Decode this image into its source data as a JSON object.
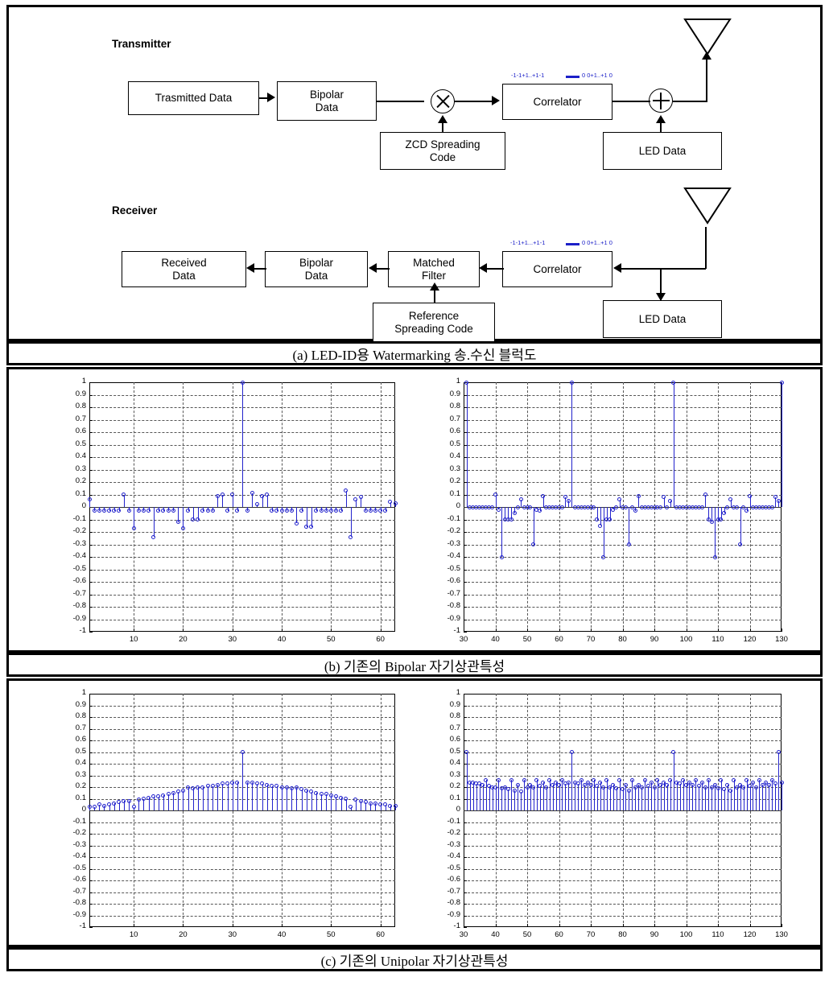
{
  "figure": {
    "captions": {
      "a": "(a) LED-ID용 Watermarking 송.수신 블럭도",
      "b": "(b) 기존의 Bipolar 자기상관특성",
      "c": "(c) 기존의 Unipolar 자기상관특성"
    }
  },
  "blockdiagram": {
    "transmitter_title": "Transmitter",
    "receiver_title": "Receiver",
    "tx_blocks": [
      {
        "id": "transmitted-data",
        "label": "Trasmitted Data"
      },
      {
        "id": "bipolar-data",
        "label": "Bipolar\nData"
      },
      {
        "id": "zcd-spreading-code",
        "label": "ZCD Spreading\nCode"
      },
      {
        "id": "correlator-tx",
        "label": "Correlator"
      },
      {
        "id": "led-data-tx",
        "label": "LED Data"
      }
    ],
    "rx_blocks": [
      {
        "id": "received-data",
        "label": "Received\nData"
      },
      {
        "id": "bipolar-data-rx",
        "label": "Bipolar\nData"
      },
      {
        "id": "matched-filter",
        "label": "Matched\nFilter"
      },
      {
        "id": "reference-spreading-code",
        "label": "Reference\nSpreading Code"
      },
      {
        "id": "correlator-rx",
        "label": "Correlator"
      },
      {
        "id": "led-data-rx",
        "label": "LED Data"
      }
    ],
    "bit_annotations": {
      "tx_left": "-1-1+1..+1-1",
      "tx_right": "0 0+1..+1 0",
      "rx_left": "-1-1+1...+1-1",
      "rx_right": "0 0+1..+1 0"
    },
    "colors": {
      "bits": "#1c20c8",
      "line": "#000000"
    }
  },
  "chart_data": [
    {
      "id": "b-left",
      "type": "stem",
      "title": "",
      "xlabel": "",
      "ylabel": "",
      "xlim": [
        1,
        63
      ],
      "ylim": [
        -1,
        1
      ],
      "xticks": [
        10,
        20,
        30,
        40,
        50,
        60
      ],
      "yticks": [
        "-1",
        "-0.9",
        "-0.8",
        "-0.7",
        "-0.6",
        "-0.5",
        "-0.4",
        "-0.3",
        "-0.2",
        "-0.1",
        "0",
        "0.1",
        "0.2",
        "0.3",
        "0.4",
        "0.5",
        "0.6",
        "0.7",
        "0.8",
        "0.9",
        "1"
      ],
      "grid": true,
      "x": [
        1,
        2,
        3,
        4,
        5,
        6,
        7,
        8,
        9,
        10,
        11,
        12,
        13,
        14,
        15,
        16,
        17,
        18,
        19,
        20,
        21,
        22,
        23,
        24,
        25,
        26,
        27,
        28,
        29,
        30,
        31,
        32,
        33,
        34,
        35,
        36,
        37,
        38,
        39,
        40,
        41,
        42,
        43,
        44,
        45,
        46,
        47,
        48,
        49,
        50,
        51,
        52,
        53,
        54,
        55,
        56,
        57,
        58,
        59,
        60,
        61,
        62,
        63
      ],
      "y": [
        0.06,
        -0.03,
        -0.03,
        -0.03,
        -0.03,
        -0.03,
        -0.03,
        0.1,
        -0.03,
        -0.17,
        -0.03,
        -0.03,
        -0.03,
        -0.24,
        -0.03,
        -0.03,
        -0.03,
        -0.03,
        -0.12,
        -0.17,
        -0.03,
        -0.1,
        -0.1,
        -0.03,
        -0.03,
        -0.03,
        0.09,
        0.1,
        -0.03,
        0.1,
        -0.03,
        1.0,
        -0.03,
        0.11,
        0.02,
        0.09,
        0.1,
        -0.03,
        -0.03,
        -0.03,
        -0.03,
        -0.03,
        -0.13,
        -0.03,
        -0.16,
        -0.16,
        -0.03,
        -0.03,
        -0.03,
        -0.03,
        -0.03,
        -0.03,
        0.13,
        -0.24,
        0.06,
        0.08,
        -0.03,
        -0.03,
        -0.03,
        -0.03,
        -0.03,
        0.04,
        0.03
      ]
    },
    {
      "id": "b-right",
      "type": "stem",
      "title": "",
      "xlabel": "",
      "ylabel": "",
      "xlim": [
        30,
        130
      ],
      "ylim": [
        -1,
        1
      ],
      "xticks": [
        30,
        40,
        50,
        60,
        70,
        80,
        90,
        100,
        110,
        120,
        130
      ],
      "yticks": [
        "-1",
        "-0.9",
        "-0.8",
        "-0.7",
        "-0.6",
        "-0.5",
        "-0.4",
        "-0.3",
        "-0.2",
        "-0.1",
        "0",
        "0.1",
        "0.2",
        "0.3",
        "0.4",
        "0.5",
        "0.6",
        "0.7",
        "0.8",
        "0.9",
        "1"
      ],
      "grid": true,
      "x": [
        31,
        32,
        33,
        34,
        35,
        36,
        37,
        38,
        39,
        40,
        41,
        42,
        43,
        44,
        45,
        46,
        47,
        48,
        49,
        50,
        51,
        52,
        53,
        54,
        55,
        56,
        57,
        58,
        59,
        60,
        61,
        62,
        63,
        64,
        65,
        66,
        67,
        68,
        69,
        70,
        71,
        72,
        73,
        74,
        75,
        76,
        77,
        78,
        79,
        80,
        81,
        82,
        83,
        84,
        85,
        86,
        87,
        88,
        89,
        90,
        91,
        92,
        93,
        94,
        95,
        96,
        97,
        98,
        99,
        100,
        101,
        102,
        103,
        104,
        105,
        106,
        107,
        108,
        109,
        110,
        111,
        112,
        113,
        114,
        115,
        116,
        117,
        118,
        119,
        120,
        121,
        122,
        123,
        124,
        125,
        126,
        127,
        128,
        129,
        130
      ],
      "y": [
        1.0,
        0,
        0,
        0,
        0,
        0,
        0,
        0,
        0,
        0.1,
        -0.02,
        -0.4,
        -0.1,
        -0.1,
        -0.1,
        -0.05,
        0,
        0.06,
        0,
        0,
        0,
        -0.3,
        -0.02,
        -0.03,
        0.09,
        0,
        0,
        0,
        0,
        0,
        0,
        0.08,
        0.05,
        1.0,
        0,
        0,
        0,
        0,
        0,
        0,
        0,
        -0.1,
        -0.15,
        -0.4,
        -0.1,
        -0.1,
        -0.02,
        0,
        0.06,
        0,
        0,
        -0.3,
        0,
        -0.03,
        0.09,
        0,
        0,
        0,
        0,
        0,
        0,
        0,
        0.08,
        0,
        0.05,
        1.0,
        0,
        0,
        0,
        0,
        0,
        0,
        0,
        0,
        0,
        0.1,
        -0.1,
        -0.12,
        -0.4,
        -0.1,
        -0.1,
        -0.05,
        0,
        0.06,
        0,
        0,
        -0.3,
        0,
        -0.03,
        0.09,
        0,
        0,
        0,
        0,
        0,
        0,
        0,
        0.08,
        0.05,
        1.0,
        0
      ]
    },
    {
      "id": "c-left",
      "type": "stem",
      "title": "",
      "xlabel": "",
      "ylabel": "",
      "xlim": [
        1,
        63
      ],
      "ylim": [
        -1,
        1
      ],
      "xticks": [
        10,
        20,
        30,
        40,
        50,
        60
      ],
      "yticks": [
        "-1",
        "-0.9",
        "-0.8",
        "-0.7",
        "-0.6",
        "-0.5",
        "-0.4",
        "-0.3",
        "-0.2",
        "-0.1",
        "0",
        "0.1",
        "0.2",
        "0.3",
        "0.4",
        "0.5",
        "0.6",
        "0.7",
        "0.8",
        "0.9",
        "1"
      ],
      "grid": true,
      "x": [
        1,
        2,
        3,
        4,
        5,
        6,
        7,
        8,
        9,
        10,
        11,
        12,
        13,
        14,
        15,
        16,
        17,
        18,
        19,
        20,
        21,
        22,
        23,
        24,
        25,
        26,
        27,
        28,
        29,
        30,
        31,
        32,
        33,
        34,
        35,
        36,
        37,
        38,
        39,
        40,
        41,
        42,
        43,
        44,
        45,
        46,
        47,
        48,
        49,
        50,
        51,
        52,
        53,
        54,
        55,
        56,
        57,
        58,
        59,
        60,
        61,
        62,
        63
      ],
      "y": [
        0.03,
        0.03,
        0.05,
        0.04,
        0.05,
        0.06,
        0.07,
        0.08,
        0.08,
        0.03,
        0.09,
        0.1,
        0.11,
        0.12,
        0.12,
        0.13,
        0.14,
        0.15,
        0.16,
        0.17,
        0.2,
        0.19,
        0.2,
        0.2,
        0.21,
        0.21,
        0.22,
        0.23,
        0.23,
        0.24,
        0.24,
        0.5,
        0.24,
        0.24,
        0.23,
        0.23,
        0.22,
        0.21,
        0.21,
        0.2,
        0.2,
        0.19,
        0.2,
        0.18,
        0.17,
        0.16,
        0.15,
        0.14,
        0.14,
        0.13,
        0.12,
        0.11,
        0.1,
        0.03,
        0.09,
        0.08,
        0.07,
        0.06,
        0.06,
        0.05,
        0.05,
        0.04,
        0.04
      ]
    },
    {
      "id": "c-right",
      "type": "stem",
      "title": "",
      "xlabel": "",
      "ylabel": "",
      "xlim": [
        30,
        130
      ],
      "ylim": [
        -1,
        1
      ],
      "xticks": [
        30,
        40,
        50,
        60,
        70,
        80,
        90,
        100,
        110,
        120,
        130
      ],
      "yticks": [
        "-1",
        "-0.9",
        "-0.8",
        "-0.7",
        "-0.6",
        "-0.5",
        "-0.4",
        "-0.3",
        "-0.2",
        "-0.1",
        "0",
        "0.1",
        "0.2",
        "0.3",
        "0.4",
        "0.5",
        "0.6",
        "0.7",
        "0.8",
        "0.9",
        "1"
      ],
      "grid": true,
      "x": [
        31,
        32,
        33,
        34,
        35,
        36,
        37,
        38,
        39,
        40,
        41,
        42,
        43,
        44,
        45,
        46,
        47,
        48,
        49,
        50,
        51,
        52,
        53,
        54,
        55,
        56,
        57,
        58,
        59,
        60,
        61,
        62,
        63,
        64,
        65,
        66,
        67,
        68,
        69,
        70,
        71,
        72,
        73,
        74,
        75,
        76,
        77,
        78,
        79,
        80,
        81,
        82,
        83,
        84,
        85,
        86,
        87,
        88,
        89,
        90,
        91,
        92,
        93,
        94,
        95,
        96,
        97,
        98,
        99,
        100,
        101,
        102,
        103,
        104,
        105,
        106,
        107,
        108,
        109,
        110,
        111,
        112,
        113,
        114,
        115,
        116,
        117,
        118,
        119,
        120,
        121,
        122,
        123,
        124,
        125,
        126,
        127,
        128,
        129,
        130
      ],
      "y": [
        0.5,
        0.24,
        0.24,
        0.23,
        0.23,
        0.22,
        0.26,
        0.21,
        0.2,
        0.2,
        0.26,
        0.19,
        0.2,
        0.18,
        0.26,
        0.17,
        0.22,
        0.16,
        0.26,
        0.2,
        0.22,
        0.2,
        0.26,
        0.21,
        0.24,
        0.2,
        0.26,
        0.22,
        0.24,
        0.22,
        0.26,
        0.23,
        0.24,
        0.5,
        0.24,
        0.23,
        0.26,
        0.22,
        0.24,
        0.22,
        0.26,
        0.21,
        0.24,
        0.2,
        0.26,
        0.2,
        0.22,
        0.19,
        0.26,
        0.18,
        0.22,
        0.17,
        0.26,
        0.2,
        0.22,
        0.2,
        0.26,
        0.21,
        0.24,
        0.2,
        0.26,
        0.22,
        0.24,
        0.22,
        0.26,
        0.5,
        0.24,
        0.23,
        0.26,
        0.22,
        0.24,
        0.22,
        0.26,
        0.21,
        0.24,
        0.2,
        0.26,
        0.2,
        0.22,
        0.19,
        0.26,
        0.18,
        0.22,
        0.17,
        0.26,
        0.2,
        0.22,
        0.2,
        0.26,
        0.21,
        0.24,
        0.2,
        0.26,
        0.22,
        0.24,
        0.22,
        0.26,
        0.23,
        0.5,
        0.24
      ]
    }
  ]
}
